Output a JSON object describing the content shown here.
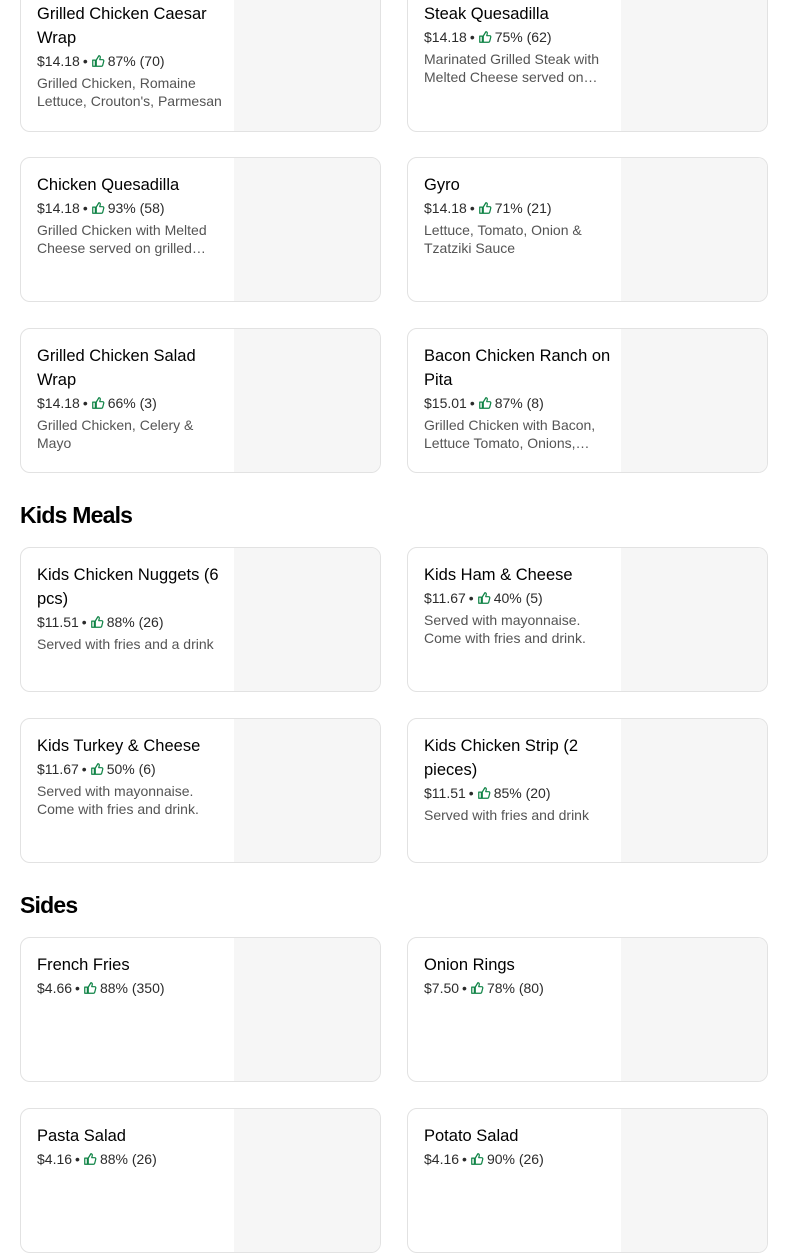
{
  "sections": {
    "kids_title": "Kids Meals",
    "sides_title": "Sides"
  },
  "items": [
    {
      "name": "Grilled Chicken Caesar Wrap",
      "price": "$14.18",
      "rating": "87% (70)",
      "desc": "Grilled Chicken, Romaine Lettuce, Crouton's, Parmesan"
    },
    {
      "name": "Steak Quesadilla",
      "price": "$14.18",
      "rating": "75% (62)",
      "desc": "Marinated Grilled Steak with Melted Cheese served on grilled tortilla"
    },
    {
      "name": "Chicken Quesadilla",
      "price": "$14.18",
      "rating": "93% (58)",
      "desc": "Grilled Chicken with Melted Cheese served on grilled tortilla"
    },
    {
      "name": "Gyro",
      "price": "$14.18",
      "rating": "71% (21)",
      "desc": "Lettuce, Tomato, Onion & Tzatziki Sauce"
    },
    {
      "name": "Grilled Chicken Salad Wrap",
      "price": "$14.18",
      "rating": "66% (3)",
      "desc": "Grilled Chicken, Celery & Mayo"
    },
    {
      "name": "Bacon Chicken Ranch on Pita",
      "price": "$15.01",
      "rating": "87% (8)",
      "desc": "Grilled Chicken with Bacon, Lettuce Tomato, Onions, Ranch"
    },
    {
      "name": "Kids Chicken Nuggets (6 pcs)",
      "price": "$11.51",
      "rating": "88% (26)",
      "desc": "Served with fries and a drink"
    },
    {
      "name": "Kids Ham & Cheese",
      "price": "$11.67",
      "rating": "40% (5)",
      "desc": "Served with mayonnaise. Come with fries and drink."
    },
    {
      "name": "Kids Turkey & Cheese",
      "price": "$11.67",
      "rating": "50% (6)",
      "desc": "Served with mayonnaise. Come with fries and drink."
    },
    {
      "name": "Kids Chicken Strip (2 pieces)",
      "price": "$11.51",
      "rating": "85% (20)",
      "desc": "Served with fries and drink"
    },
    {
      "name": "French Fries",
      "price": "$4.66",
      "rating": "88% (350)",
      "desc": ""
    },
    {
      "name": "Onion Rings",
      "price": "$7.50",
      "rating": "78% (80)",
      "desc": ""
    },
    {
      "name": "Pasta Salad",
      "price": "$4.16",
      "rating": "88% (26)",
      "desc": ""
    },
    {
      "name": "Potato Salad",
      "price": "$4.16",
      "rating": "90% (26)",
      "desc": ""
    }
  ],
  "ui": {
    "separator": "•",
    "thumb_icon": "thumbs-up-icon",
    "thumb_color": "#0e8345",
    "image_placeholder_color": "#f6f6f6"
  }
}
